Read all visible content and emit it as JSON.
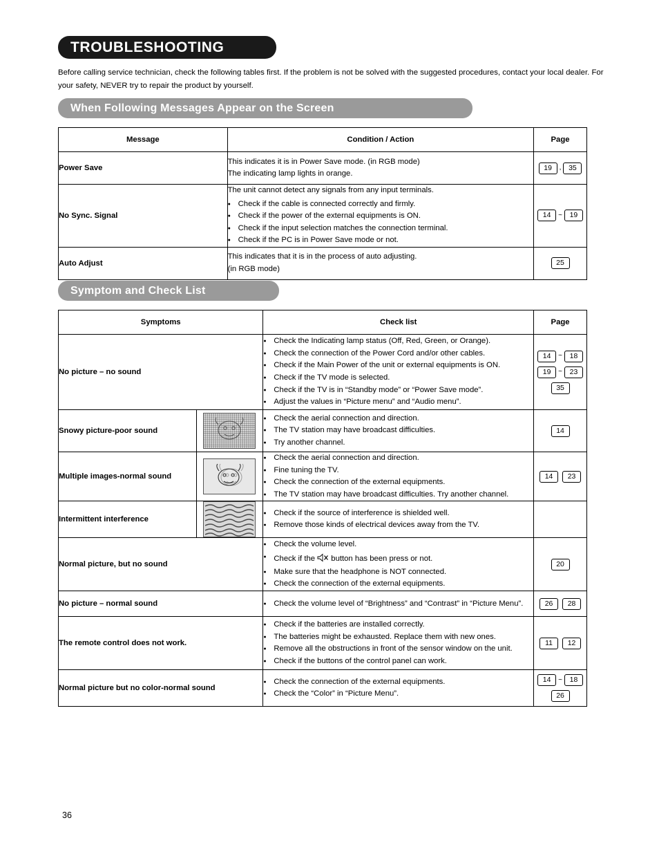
{
  "document": {
    "title": "TROUBLESHOOTING",
    "intro": "Before calling service technician, check the following tables first. If the problem is not be solved with the suggested procedures, contact your local dealer. For your safety, NEVER try to repair the product by yourself.",
    "page_number": "36"
  },
  "section1": {
    "heading": "When Following Messages Appear on the Screen",
    "columns": [
      "Message",
      "Condition / Action",
      "Page"
    ],
    "rows": [
      {
        "message": "Power Save",
        "lines": [
          "This indicates it is in Power Save mode. (in RGB mode)",
          "The indicating lamp lights in orange."
        ],
        "bullets": [],
        "pages": [
          [
            "19",
            ",",
            "35"
          ]
        ]
      },
      {
        "message": "No Sync. Signal",
        "lines": [
          "The unit cannot detect any signals from any input terminals."
        ],
        "bullets": [
          "Check if the cable is connected correctly and firmly.",
          "Check if the power of the external equipments is ON.",
          "Check if the input selection matches the connection terminal.",
          "Check if the PC is in Power Save mode or not."
        ],
        "pages": [
          [
            "14",
            "~",
            "19"
          ]
        ]
      },
      {
        "message": "Auto Adjust",
        "lines": [
          "This indicates that it is in the process of auto adjusting.",
          "(in RGB mode)"
        ],
        "bullets": [],
        "pages": [
          [
            "25"
          ]
        ]
      }
    ]
  },
  "section2": {
    "heading": "Symptom and Check List",
    "columns": [
      "Symptoms",
      "Check list",
      "Page"
    ],
    "rows": [
      {
        "symptom": "No picture – no sound",
        "thumb": null,
        "bullets": [
          "Check the Indicating lamp status (Off, Red, Green, or Orange).",
          "Check the connection of the Power Cord and/or other cables.",
          "Check if the Main Power of the unit or external equipments is ON.",
          "Check if the TV mode is selected.",
          "Check if the TV is in “Standby mode” or “Power Save mode”.",
          "Adjust the values in “Picture menu” and “Audio menu”."
        ],
        "pages": [
          [
            "14",
            "~",
            "18"
          ],
          [
            "19",
            "~",
            "23"
          ],
          [
            "35"
          ]
        ]
      },
      {
        "symptom": "Snowy picture-poor sound",
        "thumb": "snowy-picture-thumbnail",
        "bullets": [
          "Check the aerial connection and direction.",
          "The TV station may have broadcast difficulties.",
          "Try another channel."
        ],
        "pages": [
          [
            "14"
          ]
        ]
      },
      {
        "symptom": "Multiple images-normal sound",
        "thumb": "ghosting-image-thumbnail",
        "bullets": [
          "Check the aerial connection and direction.",
          "Fine tuning the TV.",
          "Check the connection of the external equipments.",
          "The TV station may have broadcast difficulties. Try another channel."
        ],
        "pages": [
          [
            "14",
            "",
            "23"
          ]
        ]
      },
      {
        "symptom": "Intermittent interference",
        "thumb": "interference-lines-thumbnail",
        "bullets": [
          "Check if the source of interference is shielded well.",
          "Remove those kinds of electrical devices away from the TV."
        ],
        "pages": []
      },
      {
        "symptom": "Normal picture, but no sound",
        "thumb": null,
        "bullets": [
          "Check the volume level.",
          "Check if the [MUTE] button has been press or not.",
          "Make sure that the headphone is NOT connected.",
          "Check the connection of the external equipments."
        ],
        "bullet_icon_index": 1,
        "bullet_icon_name": "mute-icon",
        "bullet_icon_parts": [
          "Check if the ",
          " button has been press or not."
        ],
        "pages": [
          [
            "20"
          ]
        ]
      },
      {
        "symptom": "No picture – normal sound",
        "thumb": null,
        "bullets": [
          "Check the volume level of “Brightness” and “Contrast” in “Picture Menu”."
        ],
        "pages": [
          [
            "26",
            "",
            "28"
          ]
        ]
      },
      {
        "symptom": "The remote control does not work.",
        "thumb": null,
        "bullets": [
          "Check if the batteries are installed correctly.",
          "The batteries might be exhausted. Replace them with new ones.",
          "Remove all the obstructions in front of the sensor window on the unit.",
          "Check if the buttons of the control panel can work."
        ],
        "pages": [
          [
            "11",
            "",
            "12"
          ]
        ]
      },
      {
        "symptom": "Normal picture but no color-normal sound",
        "thumb": null,
        "bullets": [
          "Check the connection of the external equipments.",
          "Check the “Color” in “Picture Menu”."
        ],
        "pages": [
          [
            "14",
            "~",
            "18"
          ],
          [
            "26"
          ]
        ]
      }
    ]
  }
}
